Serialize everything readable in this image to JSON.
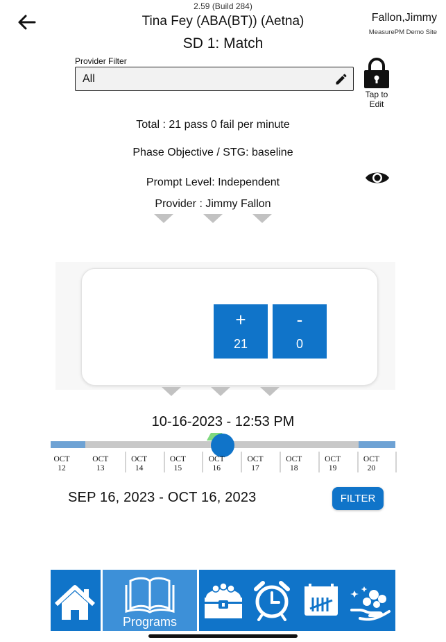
{
  "header": {
    "version": "2.59 (Build 284)",
    "patient": "Tina Fey (ABA(BT)) (Aetna)",
    "program": "SD 1: Match",
    "user_name": "Fallon,Jimmy",
    "user_site": "MeasurePM Demo Site",
    "back_icon": "arrow-left-icon"
  },
  "provider_filter": {
    "label": "Provider Filter",
    "value": "All",
    "edit_icon": "pencil-icon"
  },
  "lock": {
    "icon": "lock-icon",
    "label": "Tap to Edit"
  },
  "info": {
    "total": "Total : 21 pass 0 fail per minute",
    "phase": "Phase Objective / STG: baseline",
    "prompt": "Prompt Level: Independent",
    "provider": "Provider : Jimmy Fallon",
    "visibility_icon": "eye-icon"
  },
  "counter": {
    "plus_symbol": "+",
    "plus_value": "21",
    "minus_symbol": "-",
    "minus_value": "0"
  },
  "session": {
    "datetime": "10-16-2023 - 12:53 PM"
  },
  "timeline": {
    "labels": [
      {
        "month": "OCT",
        "day": "12"
      },
      {
        "month": "OCT",
        "day": "13"
      },
      {
        "month": "OCT",
        "day": "14"
      },
      {
        "month": "OCT",
        "day": "15"
      },
      {
        "month": "OCT",
        "day": "16"
      },
      {
        "month": "OCT",
        "day": "17"
      },
      {
        "month": "OCT",
        "day": "18"
      },
      {
        "month": "OCT",
        "day": "19"
      },
      {
        "month": "OCT",
        "day": "20"
      }
    ]
  },
  "range": {
    "text": "SEP 16, 2023  -  OCT 16, 2023",
    "filter_button": "FILTER"
  },
  "nav": {
    "items": [
      {
        "icon": "home-icon",
        "label": ""
      },
      {
        "icon": "book-icon",
        "label": "Programs"
      },
      {
        "icon": "treasure-chest-icon",
        "label": ""
      },
      {
        "icon": "alarm-clock-icon",
        "label": ""
      },
      {
        "icon": "tally-calendar-icon",
        "label": ""
      },
      {
        "icon": "hand-coins-icon",
        "label": ""
      }
    ],
    "active": "Programs"
  },
  "colors": {
    "accent": "#1074c9",
    "accent_active": "#3d90d8",
    "timeline_edge": "#6ea2d4",
    "timeline_track": "#c8c8c8"
  }
}
